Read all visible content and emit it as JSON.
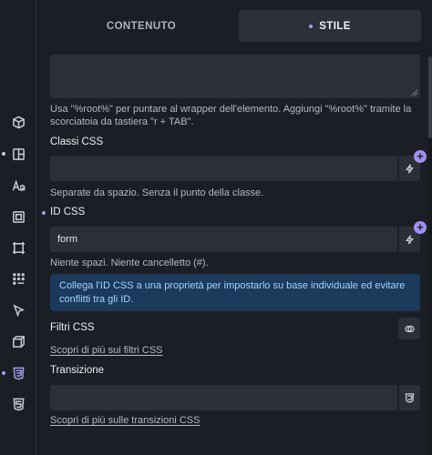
{
  "tabs": {
    "content_label": "CONTENUTO",
    "style_label": "STILE"
  },
  "root_help": "Usa \"%root%\" per puntare al wrapper dell'elemento. Aggiungi \"%root%\" tramite la scorciatoia da tastiera \"r + TAB\".",
  "css_classes": {
    "label": "Classi CSS",
    "value": "",
    "help": "Separate da spazio. Senza il punto della classe.",
    "plus": "+"
  },
  "css_id": {
    "label": "ID CSS",
    "value": "form",
    "help": "Niente spazi. Niente cancelletto (#).",
    "plus": "+"
  },
  "info": "Collega l'ID CSS a una proprietà per impostarlo su base individuale ed evitare conflitti tra gli ID.",
  "filters": {
    "label": "Filtri CSS",
    "link": "Scopri di più sui filtri CSS"
  },
  "transition": {
    "label": "Transizione",
    "value": "",
    "link": "Scopri di più sulle transizioni CSS"
  },
  "rail_icons": [
    "cube-icon",
    "layout-icon",
    "typography-icon",
    "spacing-icon",
    "border-icon",
    "grid-dots-icon",
    "cursor-icon",
    "transform-icon",
    "css3-icon",
    "html5-icon"
  ],
  "colors": {
    "accent": "#a79bf0",
    "info_bg": "#1b3a5c",
    "info_text": "#a6d4ff"
  }
}
